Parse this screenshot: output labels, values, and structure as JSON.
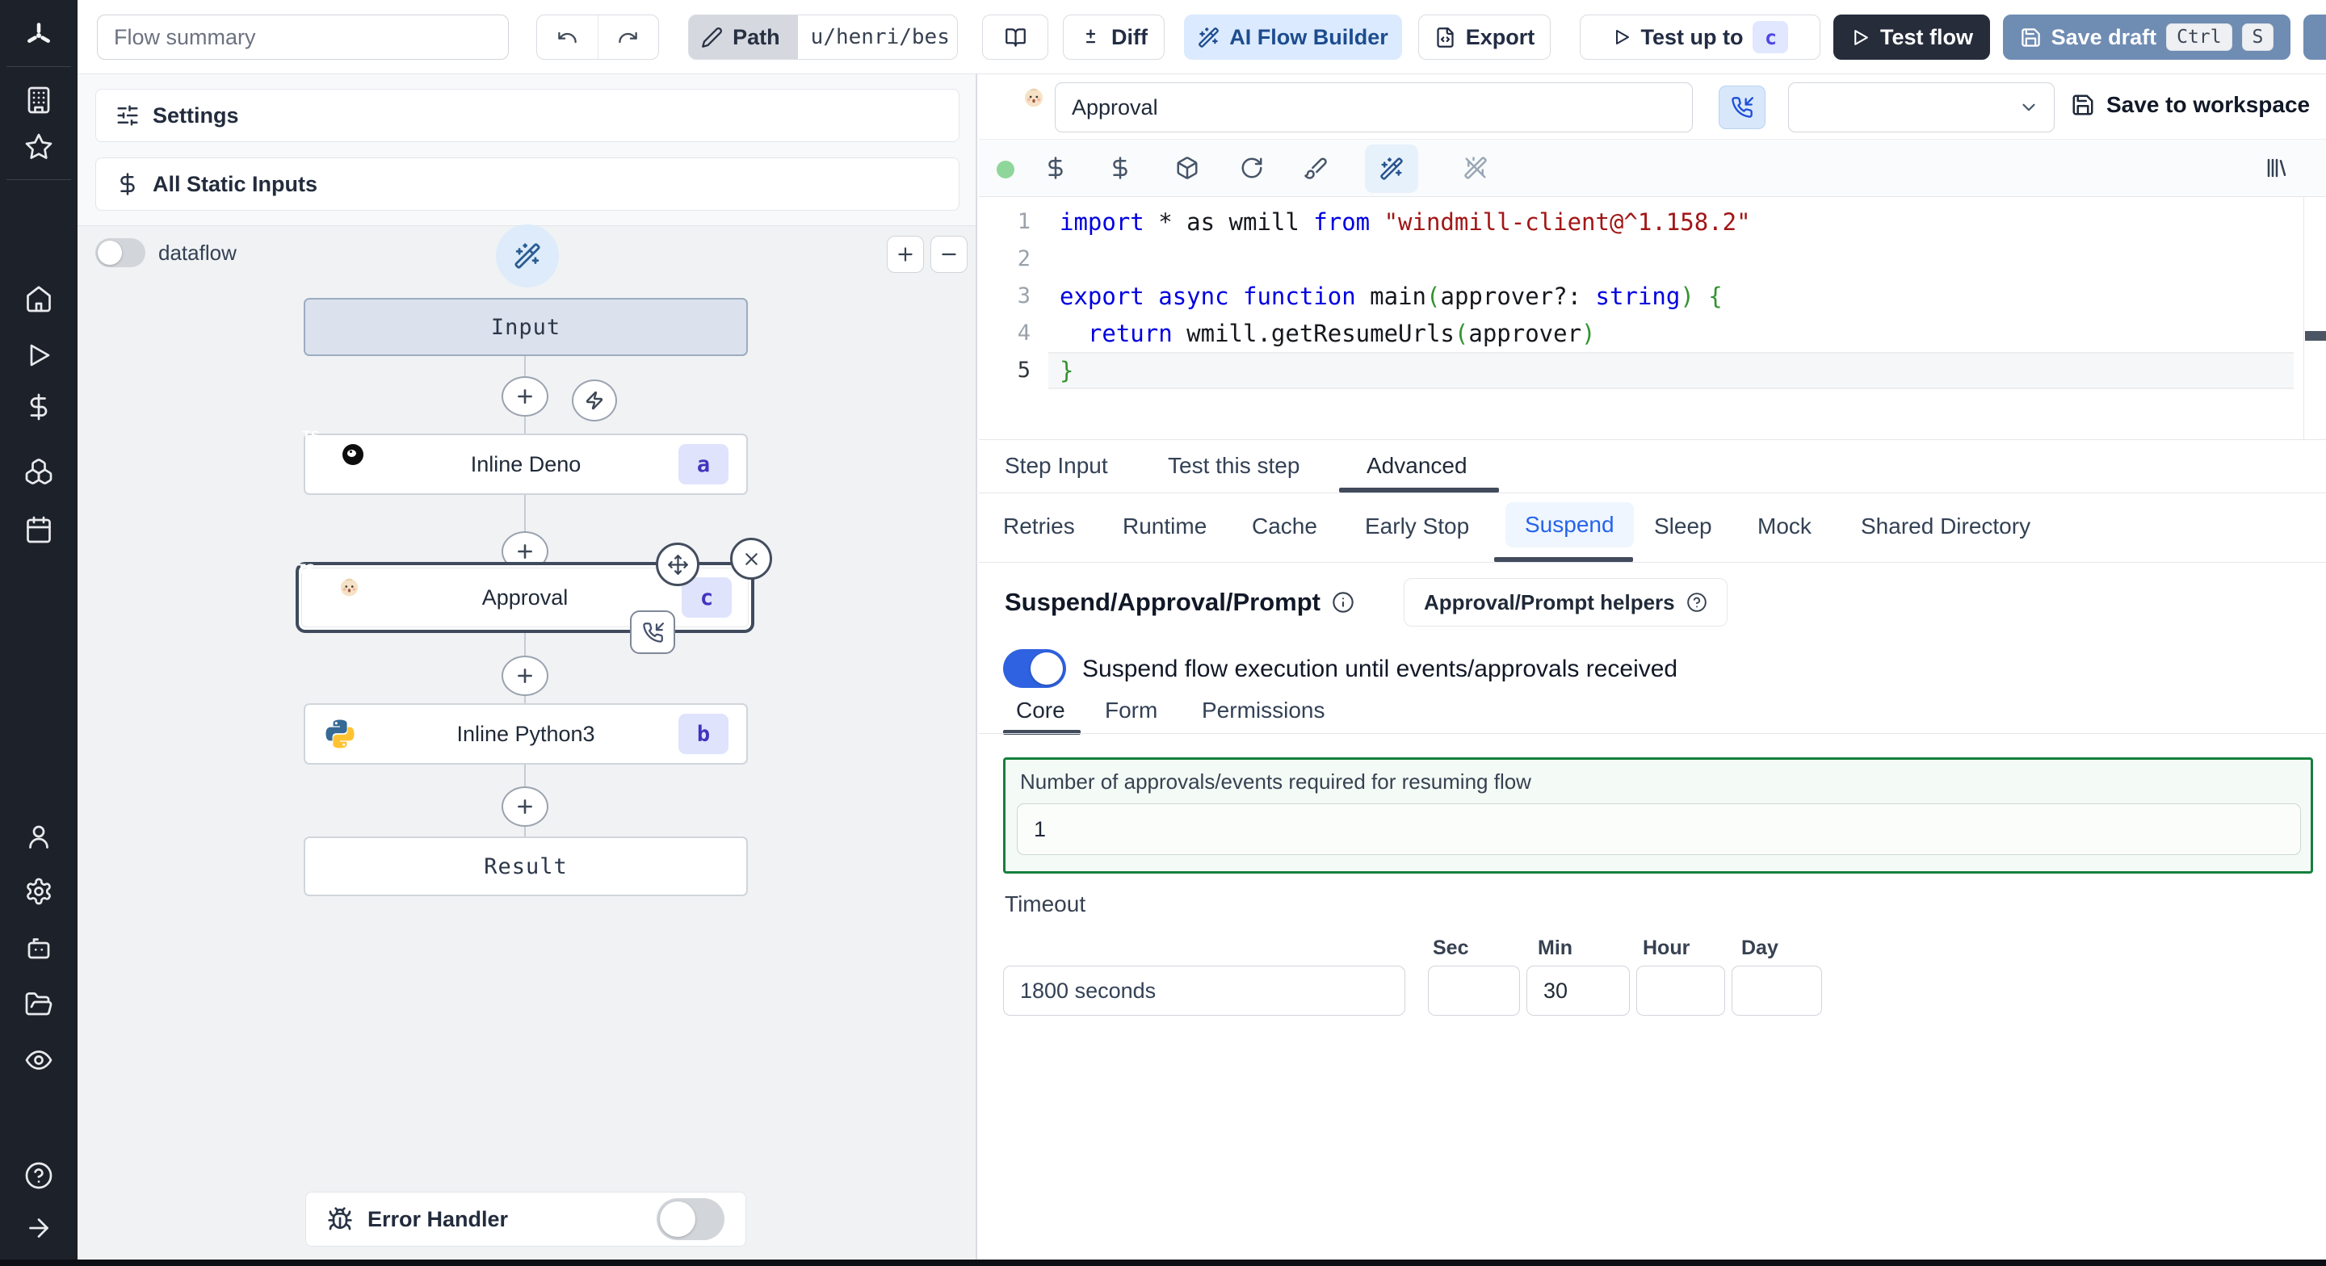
{
  "topbar": {
    "summary_placeholder": "Flow summary",
    "path_label": "Path",
    "path_value": "u/henri/bes",
    "diff_label": "Diff",
    "ai_builder_label": "AI Flow Builder",
    "export_label": "Export",
    "test_up_to_label": "Test up to",
    "test_up_to_badge": "c",
    "test_flow_label": "Test flow",
    "save_draft_label": "Save draft",
    "kbd_ctrl": "Ctrl",
    "kbd_s": "S"
  },
  "left_panel": {
    "settings_label": "Settings",
    "static_inputs_label": "All Static Inputs",
    "dataflow_label": "dataflow",
    "zoom_in_label": "+",
    "zoom_out_label": "−",
    "error_handler_label": "Error Handler"
  },
  "flow": {
    "input_label": "Input",
    "result_label": "Result",
    "steps": [
      {
        "name": "Inline Deno",
        "badge": "a"
      },
      {
        "name": "Approval",
        "badge": "c"
      },
      {
        "name": "Inline Python3",
        "badge": "b"
      }
    ]
  },
  "step_panel": {
    "name_value": "Approval",
    "save_to_workspace_label": "Save to workspace",
    "tabs": {
      "step_input": "Step Input",
      "test_this_step": "Test this step",
      "advanced": "Advanced"
    },
    "subtabs": [
      "Retries",
      "Runtime",
      "Cache",
      "Early Stop",
      "Suspend",
      "Sleep",
      "Mock",
      "Shared Directory"
    ],
    "suspend": {
      "heading": "Suspend/Approval/Prompt",
      "helpers_label": "Approval/Prompt helpers",
      "toggle_label": "Suspend flow execution until events/approvals received",
      "inner_tabs": [
        "Core",
        "Form",
        "Permissions"
      ],
      "approvals_label": "Number of approvals/events required for resuming flow",
      "approvals_value": "1",
      "timeout_label": "Timeout",
      "timeout_value": "1800 seconds",
      "unit_labels": [
        "Sec",
        "Min",
        "Hour",
        "Day"
      ],
      "sec_value": "",
      "min_value": "30",
      "hour_value": "",
      "day_value": ""
    }
  },
  "code": {
    "active_line": 5,
    "lines": [
      [
        {
          "t": "import",
          "c": "k"
        },
        {
          "t": " * as wmill ",
          "c": "p"
        },
        {
          "t": "from",
          "c": "k"
        },
        {
          "t": " ",
          "c": "p"
        },
        {
          "t": "\"windmill-client@^1.158.2\"",
          "c": "s"
        }
      ],
      [],
      [
        {
          "t": "export",
          "c": "k"
        },
        {
          "t": " ",
          "c": "p"
        },
        {
          "t": "async",
          "c": "k"
        },
        {
          "t": " ",
          "c": "p"
        },
        {
          "t": "function",
          "c": "k"
        },
        {
          "t": " main",
          "c": "p"
        },
        {
          "t": "(",
          "c": "b"
        },
        {
          "t": "approver?: ",
          "c": "p"
        },
        {
          "t": "string",
          "c": "k"
        },
        {
          "t": ")",
          "c": "b"
        },
        {
          "t": " ",
          "c": "p"
        },
        {
          "t": "{",
          "c": "b"
        }
      ],
      [
        {
          "t": "  ",
          "c": "p"
        },
        {
          "t": "return",
          "c": "k"
        },
        {
          "t": " wmill.getResumeUrls",
          "c": "p"
        },
        {
          "t": "(",
          "c": "b"
        },
        {
          "t": "approver",
          "c": "p"
        },
        {
          "t": ")",
          "c": "b"
        }
      ],
      [
        {
          "t": "}",
          "c": "b"
        }
      ]
    ]
  },
  "colors": {
    "accent_blue": "#2f62e0",
    "ai_button_bg": "#dbeafe",
    "save_draft_bg": "#6f8cb3",
    "test_flow_bg": "#262c3a",
    "badge_bg": "#dfe3fc",
    "badge_text": "#4334be",
    "suspend_active": "#2563eb",
    "green_border": "#15803d"
  }
}
